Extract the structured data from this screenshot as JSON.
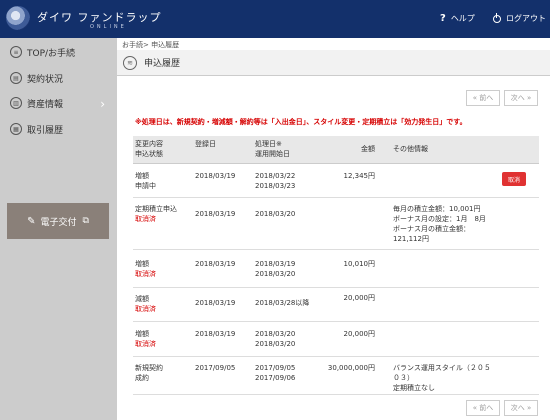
{
  "header": {
    "logo_text": "ダイワ ファンドラップ",
    "logo_sub": "ONLINE",
    "help_label": "ヘルプ",
    "logout_label": "ログアウト"
  },
  "sidebar": {
    "items": [
      {
        "label": "TOP/お手続"
      },
      {
        "label": "契約状況"
      },
      {
        "label": "資産情報"
      },
      {
        "label": "取引履歴"
      }
    ],
    "ekofu_label": "電子交付"
  },
  "main": {
    "breadcrumb": "お手続> 申込履歴",
    "title": "申込履歴",
    "prev_label": "« 前へ",
    "next_label": "次へ »",
    "note": "※処理日は、新規契約・増減額・解約等は「入出金日」、スタイル変更・定期積立は「効力発生日」です。",
    "columns": {
      "c1a": "変更内容",
      "c1b": "申込状態",
      "c2": "登録日",
      "c3a": "処理日※",
      "c3b": "運用開始日",
      "c4": "金額",
      "c5": "その他情報"
    },
    "rows": [
      {
        "type": "増額",
        "status": "申請中",
        "reg": "2018/03/19",
        "proc1": "2018/03/22",
        "proc2": "2018/03/23",
        "amount": "12,345円",
        "info": [],
        "cancel": "取消"
      },
      {
        "type": "定期積立申込",
        "status": "取消済",
        "reg": "2018/03/19",
        "proc1": "2018/03/20",
        "proc2": "",
        "amount": "",
        "info": [
          "毎月の積立金額：10,001円",
          "ボーナス月の設定：1月　8月",
          "ボーナス月の積立金額：",
          "121,112円"
        ],
        "cancel": ""
      },
      {
        "type": "増額",
        "status": "取消済",
        "reg": "2018/03/19",
        "proc1": "2018/03/19",
        "proc2": "2018/03/20",
        "amount": "10,010円",
        "info": [],
        "cancel": ""
      },
      {
        "type": "減額",
        "status": "取消済",
        "reg": "2018/03/19",
        "proc1": "2018/03/28以降",
        "proc2": "",
        "amount": "20,000円",
        "info": [],
        "cancel": ""
      },
      {
        "type": "増額",
        "status": "取消済",
        "reg": "2018/03/19",
        "proc1": "2018/03/20",
        "proc2": "2018/03/20",
        "amount": "20,000円",
        "info": [],
        "cancel": ""
      },
      {
        "type": "新規契約",
        "status": "成約",
        "reg": "2017/09/05",
        "proc1": "2017/09/05",
        "proc2": "2017/09/06",
        "amount": "30,000,000円",
        "info": [
          "バランス運用スタイル（２０５",
          "０３）",
          "定期積立なし"
        ],
        "cancel": ""
      }
    ]
  }
}
